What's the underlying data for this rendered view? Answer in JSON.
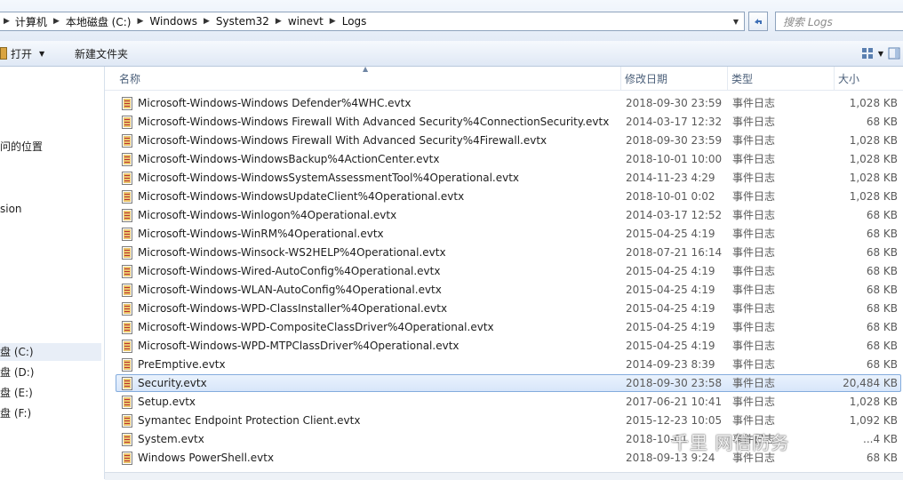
{
  "breadcrumb": [
    "计算机",
    "本地磁盘 (C:)",
    "Windows",
    "System32",
    "winevt",
    "Logs"
  ],
  "search": {
    "placeholder": "搜索 Logs"
  },
  "toolbar": {
    "open_label": "打开",
    "new_folder_label": "新建文件夹"
  },
  "nav": {
    "items": [
      {
        "label": "问的位置",
        "selected": false
      },
      {
        "label": "sion",
        "selected": false
      },
      {
        "label": "盘 (C:)",
        "selected": true
      },
      {
        "label": "盘 (D:)",
        "selected": false
      },
      {
        "label": "盘 (E:)",
        "selected": false
      },
      {
        "label": "盘 (F:)",
        "selected": false
      }
    ]
  },
  "columns": {
    "name": "名称",
    "date": "修改日期",
    "type": "类型",
    "size": "大小"
  },
  "files": [
    {
      "name": "Microsoft-Windows-Windows Defender%4WHC.evtx",
      "date": "2018-09-30 23:59",
      "type": "事件日志",
      "size": "1,028 KB"
    },
    {
      "name": "Microsoft-Windows-Windows Firewall With Advanced Security%4ConnectionSecurity.evtx",
      "date": "2014-03-17 12:32",
      "type": "事件日志",
      "size": "68 KB"
    },
    {
      "name": "Microsoft-Windows-Windows Firewall With Advanced Security%4Firewall.evtx",
      "date": "2018-09-30 23:59",
      "type": "事件日志",
      "size": "1,028 KB"
    },
    {
      "name": "Microsoft-Windows-WindowsBackup%4ActionCenter.evtx",
      "date": "2018-10-01 10:00",
      "type": "事件日志",
      "size": "1,028 KB"
    },
    {
      "name": "Microsoft-Windows-WindowsSystemAssessmentTool%4Operational.evtx",
      "date": "2014-11-23 4:29",
      "type": "事件日志",
      "size": "1,028 KB"
    },
    {
      "name": "Microsoft-Windows-WindowsUpdateClient%4Operational.evtx",
      "date": "2018-10-01 0:02",
      "type": "事件日志",
      "size": "1,028 KB"
    },
    {
      "name": "Microsoft-Windows-Winlogon%4Operational.evtx",
      "date": "2014-03-17 12:52",
      "type": "事件日志",
      "size": "68 KB"
    },
    {
      "name": "Microsoft-Windows-WinRM%4Operational.evtx",
      "date": "2015-04-25 4:19",
      "type": "事件日志",
      "size": "68 KB"
    },
    {
      "name": "Microsoft-Windows-Winsock-WS2HELP%4Operational.evtx",
      "date": "2018-07-21 16:14",
      "type": "事件日志",
      "size": "68 KB"
    },
    {
      "name": "Microsoft-Windows-Wired-AutoConfig%4Operational.evtx",
      "date": "2015-04-25 4:19",
      "type": "事件日志",
      "size": "68 KB"
    },
    {
      "name": "Microsoft-Windows-WLAN-AutoConfig%4Operational.evtx",
      "date": "2015-04-25 4:19",
      "type": "事件日志",
      "size": "68 KB"
    },
    {
      "name": "Microsoft-Windows-WPD-ClassInstaller%4Operational.evtx",
      "date": "2015-04-25 4:19",
      "type": "事件日志",
      "size": "68 KB"
    },
    {
      "name": "Microsoft-Windows-WPD-CompositeClassDriver%4Operational.evtx",
      "date": "2015-04-25 4:19",
      "type": "事件日志",
      "size": "68 KB"
    },
    {
      "name": "Microsoft-Windows-WPD-MTPClassDriver%4Operational.evtx",
      "date": "2015-04-25 4:19",
      "type": "事件日志",
      "size": "68 KB"
    },
    {
      "name": "PreEmptive.evtx",
      "date": "2014-09-23 8:39",
      "type": "事件日志",
      "size": "68 KB"
    },
    {
      "name": "Security.evtx",
      "date": "2018-09-30 23:58",
      "type": "事件日志",
      "size": "20,484 KB",
      "selected": true
    },
    {
      "name": "Setup.evtx",
      "date": "2017-06-21 10:41",
      "type": "事件日志",
      "size": "1,028 KB"
    },
    {
      "name": "Symantec Endpoint Protection Client.evtx",
      "date": "2015-12-23 10:05",
      "type": "事件日志",
      "size": "1,092 KB"
    },
    {
      "name": "System.evtx",
      "date": "2018-10-01 ...",
      "type": "事件日志",
      "size": "...4 KB"
    },
    {
      "name": "Windows PowerShell.evtx",
      "date": "2018-09-13 9:24",
      "type": "事件日志",
      "size": "68 KB"
    }
  ],
  "watermark": "千里  网信防务",
  "colors": {
    "selection_border": "#84acdd",
    "selection_fill": "#d7e6fa",
    "header_text": "#4c607a"
  }
}
